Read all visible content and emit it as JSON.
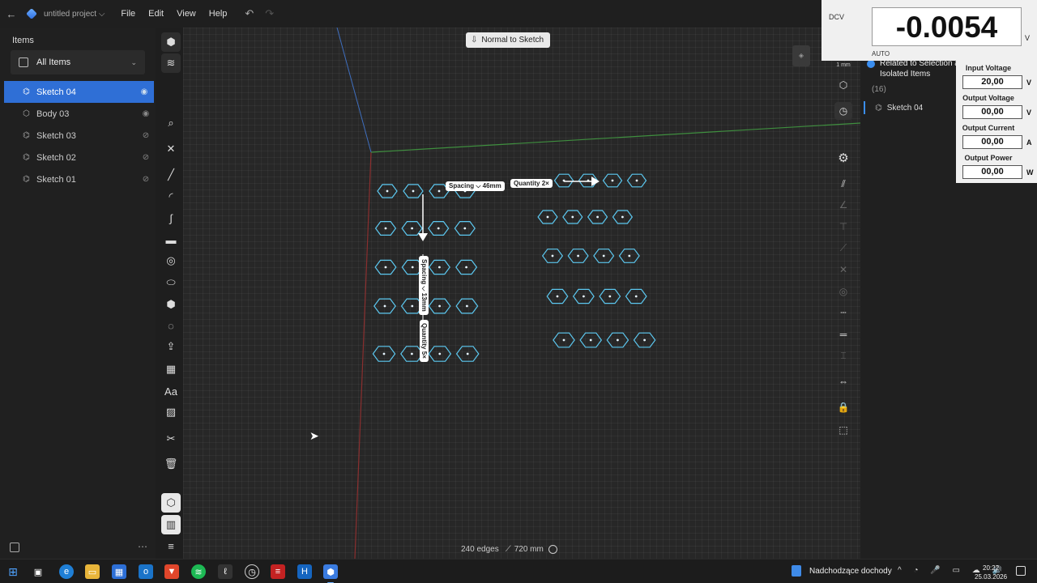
{
  "topbar": {
    "project_name": "untitled project",
    "menu": [
      "File",
      "Edit",
      "View",
      "Help"
    ]
  },
  "items_panel": {
    "title": "Items",
    "filter_label": "All Items",
    "items": [
      {
        "label": "Sketch 04",
        "icon": "sketch-icon",
        "selected": true,
        "visible": true
      },
      {
        "label": "Body 03",
        "icon": "body-icon",
        "selected": false,
        "visible": true
      },
      {
        "label": "Sketch 03",
        "icon": "sketch-icon",
        "selected": false,
        "visible": false
      },
      {
        "label": "Sketch 02",
        "icon": "sketch-icon",
        "selected": false,
        "visible": false
      },
      {
        "label": "Sketch 01",
        "icon": "sketch-icon",
        "selected": false,
        "visible": false
      }
    ]
  },
  "viewport": {
    "normal_to_sketch_label": "Normal to Sketch",
    "pattern_horizontal": {
      "spacing_label": "Spacing",
      "spacing_value": "46mm",
      "quantity_label": "Quantity",
      "quantity_value": "2×"
    },
    "pattern_vertical": {
      "spacing_label": "Spacing",
      "spacing_value": "13mm",
      "quantity_label": "Quantity",
      "quantity_value": "5×"
    },
    "status_edges": "240 edges",
    "status_length": "720 mm"
  },
  "right_panel": {
    "related_line1": "Related to Selection a",
    "related_line2": "Isolated Items",
    "count": "(16)",
    "sketch_label": "Sketch 04",
    "scale_label": "1 mm"
  },
  "dcv_meter": {
    "label": "DCV",
    "reading": "-0.0054",
    "unit": "V",
    "mode": "AUTO"
  },
  "power_panel": {
    "fields": [
      {
        "label": "Input Voltage",
        "value": "20,00",
        "unit": "V"
      },
      {
        "label": "Output Voltage",
        "value": "00,00",
        "unit": "V"
      },
      {
        "label": "Output Current",
        "value": "00,00",
        "unit": "A"
      },
      {
        "label": "Output Power",
        "value": "00,00",
        "unit": "W"
      }
    ]
  },
  "taskbar": {
    "news_label": "Nadchodzące dochody",
    "time": "20:22",
    "date": "25.03.2026"
  },
  "colors": {
    "accent": "#2f6fd6",
    "sketch_stroke": "#5cc8f0",
    "axis_red": "#8a2f2f",
    "axis_green": "#3f8f3f",
    "axis_blue": "#3f6fbf"
  }
}
